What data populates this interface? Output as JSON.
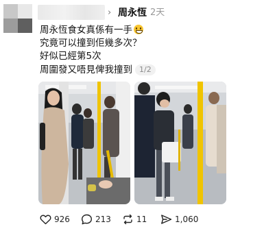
{
  "post": {
    "author": "周永恆",
    "time": "2天",
    "lines": [
      "周永恆食女真係有一手",
      "究竟可以撞到佢幾多次？",
      "好似已經第5次",
      "周圍發又唔見俾我撞到"
    ],
    "image_counter": "1/2",
    "icons": {
      "avatar": "avatar-pixelated",
      "chevron": "chevron-right-icon",
      "emoji": "grinning-face-emoji"
    }
  },
  "actions": {
    "like": {
      "icon": "heart-icon",
      "count": "926"
    },
    "comment": {
      "icon": "comment-bubble-icon",
      "count": "213"
    },
    "repost": {
      "icon": "repost-icon",
      "count": "11"
    },
    "share": {
      "icon": "send-icon",
      "count": "1,060"
    }
  },
  "colors": {
    "text": "#141414",
    "muted": "#9a9a9a",
    "train_pole": "#f0c400",
    "background": "#ffffff"
  }
}
